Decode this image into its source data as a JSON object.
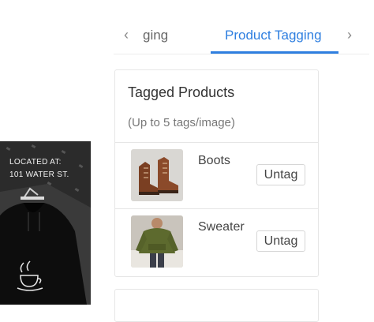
{
  "promo": {
    "line1": "LOCATED AT:",
    "line2": "101 WATER ST."
  },
  "tabs": {
    "previous_label": "ging",
    "active_label": "Product Tagging",
    "left_arrow": "‹",
    "right_arrow": "›"
  },
  "tagged": {
    "title": "Tagged Products",
    "subtitle": "(Up to 5 tags/image)",
    "items": [
      {
        "name": "Boots",
        "button": "Untag",
        "thumb_icon": "boots-icon"
      },
      {
        "name": "Sweater",
        "button": "Untag",
        "thumb_icon": "sweater-icon"
      }
    ]
  }
}
